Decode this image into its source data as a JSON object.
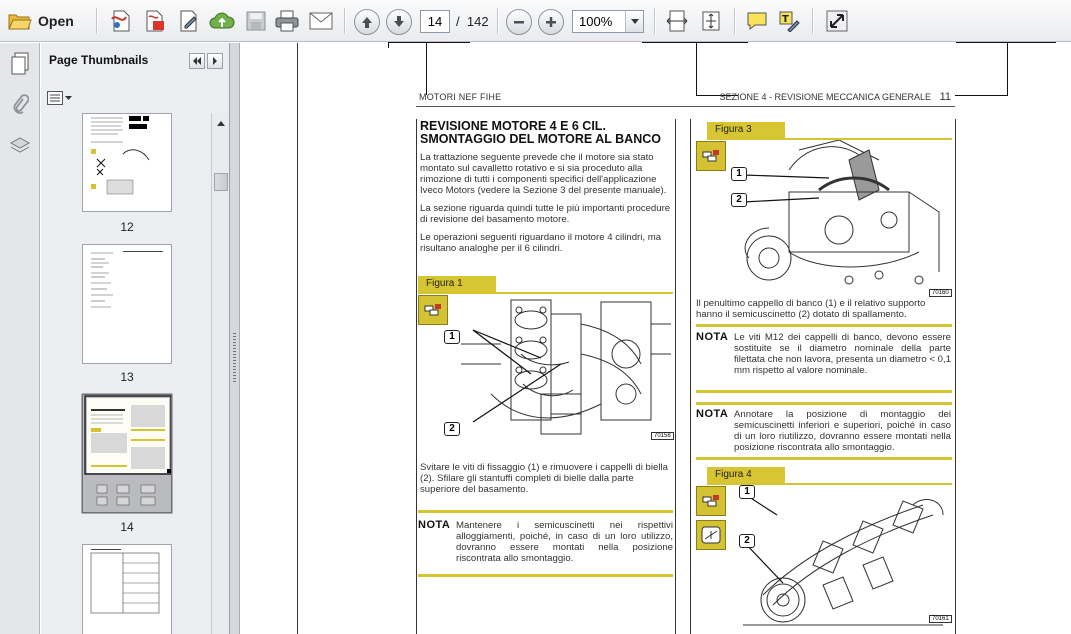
{
  "toolbar": {
    "open_label": "Open",
    "page_current": "14",
    "page_separator": "/",
    "page_total": "142",
    "zoom_value": "100%",
    "icons": [
      "open-folder-icon",
      "create-pdf-icon",
      "export-pdf-icon",
      "edit-pdf-icon",
      "upload-cloud-icon",
      "save-icon",
      "print-icon",
      "email-icon",
      "previous-page-icon",
      "next-page-icon",
      "zoom-out-icon",
      "zoom-in-icon",
      "fit-width-icon",
      "fit-page-icon",
      "comment-icon",
      "highlight-text-icon",
      "fullscreen-icon"
    ]
  },
  "sidebar": {
    "title": "Page Thumbnails",
    "thumbnails": [
      {
        "label": "12"
      },
      {
        "label": "13"
      },
      {
        "label": "14",
        "selected": true
      },
      {
        "label": ""
      }
    ]
  },
  "document": {
    "running_header_left": "MOTORI NEF FIHE",
    "running_header_right": "SEZIONE 4 - REVISIONE MECCANICA GENERALE",
    "page_number": "11",
    "heading_line1": "REVISIONE MOTORE 4 E 6 CIL.",
    "heading_line2": "SMONTAGGIO DEL MOTORE AL BANCO",
    "para1": "La trattazione seguente prevede che il motore sia stato montato sul cavalletto rotativo e si sia proceduto alla rimozione di tutti i componenti specifici dell'applicazione Iveco Motors (vedere la Sezione 3 del presente manuale).",
    "para2": "La sezione riguarda quindi tutte le più importanti procedure di revisione del basamento motore.",
    "para3": "Le operazioni seguenti riguardano il motore 4 cilindri, ma risultano analoghe per il 6 cilindri.",
    "figure1_label": "Figura 1",
    "figure1_code": "70158",
    "figure1_caption": "Svitare le viti di fissaggio (1) e rimuovere i cappelli di biella (2). Sfilare gli stantuffi completi di bielle dalla parte superiore del basamento.",
    "nota_label": "NOTA",
    "nota1": "Mantenere i semicuscinetti nei rispettivi alloggiamenti, poiché, in caso di un loro utilizzo, dovranno essere montati nella posizione riscontrata allo smontaggio.",
    "figure3_label": "Figura 3",
    "figure3_code": "70160",
    "figure3_caption": "Il penultimo cappello di banco (1) e il relativo supporto hanno il semicuscinetto (2) dotato di spallamento.",
    "nota2": "Le viti M12 dei cappelli di banco, devono essere sostituite se il diametro nominale della parte filettata che non lavora, presenta un diametro < 0,1 mm rispetto al valore nominale.",
    "nota3": "Annotare la posizione di montaggio dei semicuscinetti inferiori e superiori, poiché in caso di un loro riutilizzo, dovranno essere montati nella posizione riscontrata allo smontaggio.",
    "figure4_label": "Figura 4",
    "figure4_code": "70161",
    "callout_1": "1",
    "callout_2": "2"
  },
  "colors": {
    "figure_tab": "#d7c531",
    "accent_rule": "#d4c433"
  }
}
